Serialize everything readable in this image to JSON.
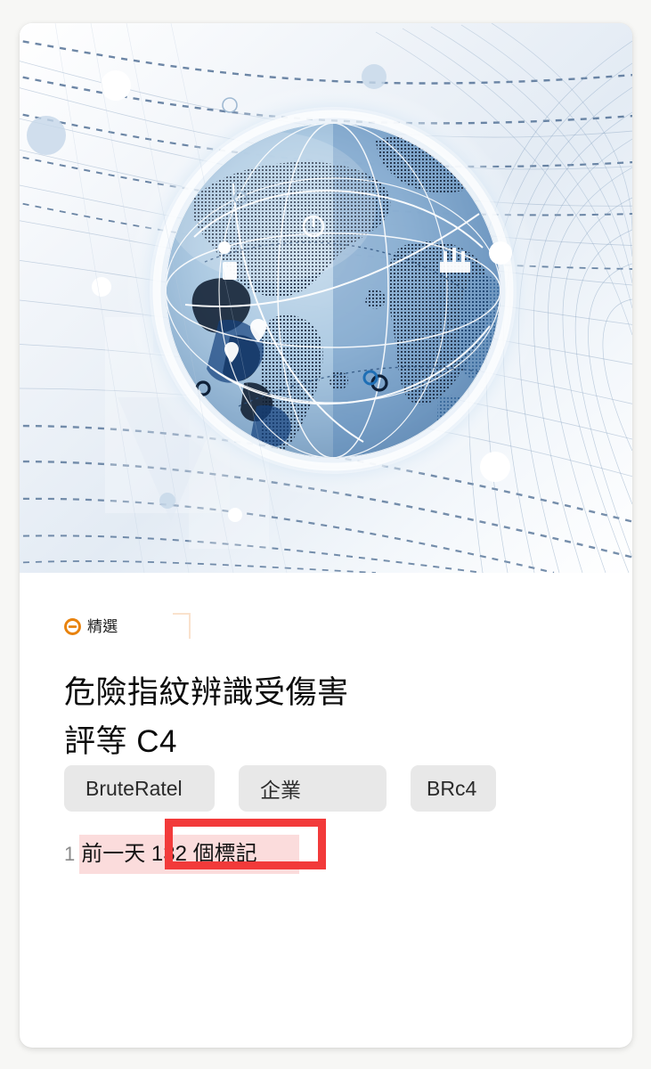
{
  "card": {
    "hero": {
      "alt": "abstract digital globe with network connection lines",
      "icon_name": "globe-network-illustration"
    },
    "featured": {
      "icon_name": "minus-circle-icon",
      "label": "精選",
      "icon_color": "#e8820c"
    },
    "title": {
      "line1": "危險指紋辨識受傷害",
      "line2": "評等 C4"
    },
    "tags": [
      {
        "label": "BruteRatel"
      },
      {
        "label": "企業"
      },
      {
        "label": "BRc4"
      }
    ],
    "meta": {
      "index": "1",
      "text": "前一天 132 個標記",
      "highlight_color": "#fbdcdc"
    },
    "annotation": {
      "shape": "rectangle",
      "color": "#f23a3a"
    }
  }
}
